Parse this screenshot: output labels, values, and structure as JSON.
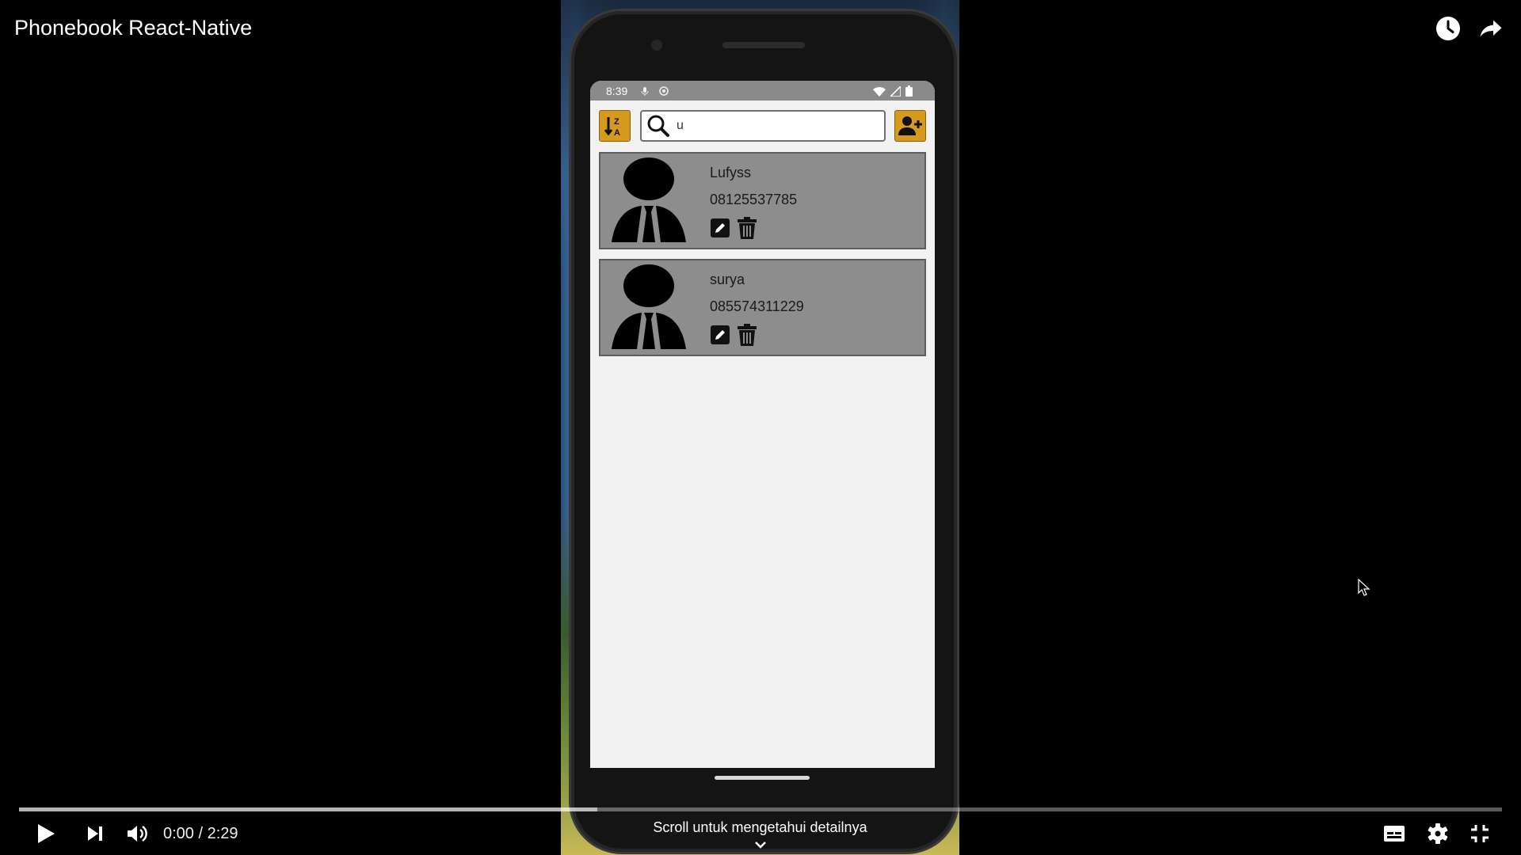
{
  "video": {
    "title": "Phonebook React-Native",
    "time_current": "0:00",
    "time_separator": "/",
    "time_total": "2:29",
    "caption": "Scroll untuk mengetahui detailnya",
    "progress_fraction": 0.0,
    "buffered_fraction": 0.39
  },
  "phone": {
    "status_time": "8:39",
    "search_value": "u",
    "accent_color": "#d59a1e",
    "contacts": [
      {
        "name": "Lufyss",
        "phone": "08125537785"
      },
      {
        "name": "surya",
        "phone": "085574311229"
      }
    ]
  },
  "icons": {
    "top_right": [
      "watch-later-icon",
      "share-icon"
    ],
    "toolbar": [
      "sort-icon",
      "search-icon",
      "add-user-icon"
    ],
    "card_actions": [
      "edit-icon",
      "trash-icon"
    ],
    "controls": [
      "play-icon",
      "next-icon",
      "volume-icon",
      "subtitles-icon",
      "settings-icon",
      "exit-fullscreen-icon"
    ]
  }
}
